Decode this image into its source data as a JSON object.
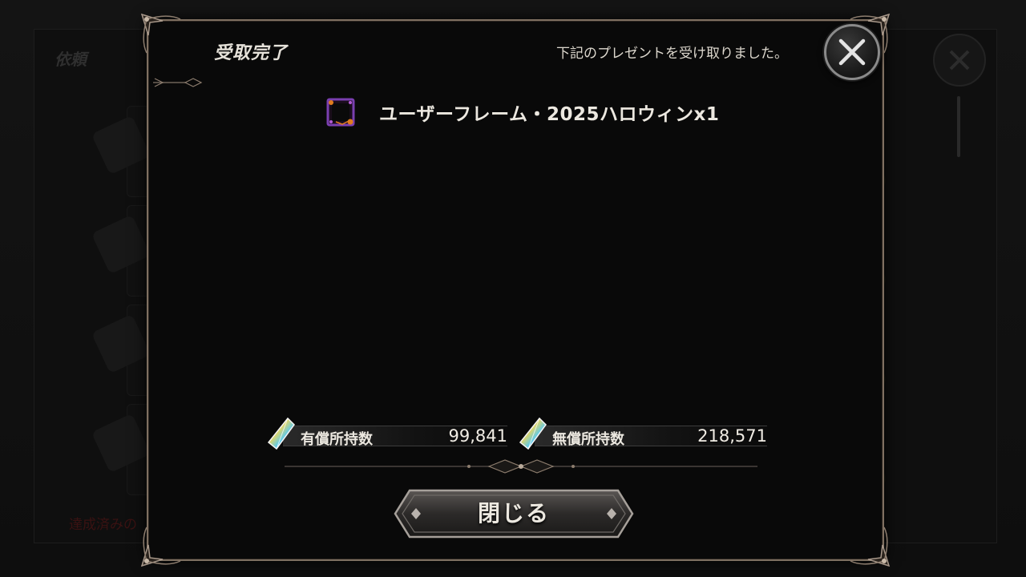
{
  "background": {
    "screen_title": "依頼",
    "footer_text": "達成済みの"
  },
  "modal": {
    "title": "受取完了",
    "subtitle": "下記のプレゼントを受け取りました。",
    "close_icon": "close-x-icon"
  },
  "reward": {
    "icon": "user-frame-icon",
    "text": "ユーザーフレーム・2025ハロウィンx1"
  },
  "currency": {
    "paid": {
      "label": "有償所持数",
      "value": "99,841",
      "icon": "crystal-gem-icon"
    },
    "free": {
      "label": "無償所持数",
      "value": "218,571",
      "icon": "crystal-gem-icon"
    }
  },
  "close_button": {
    "label": "閉じる"
  },
  "colors": {
    "frame_border": "#7f7061",
    "modal_bg": "#090909",
    "text": "#ece8e0"
  }
}
